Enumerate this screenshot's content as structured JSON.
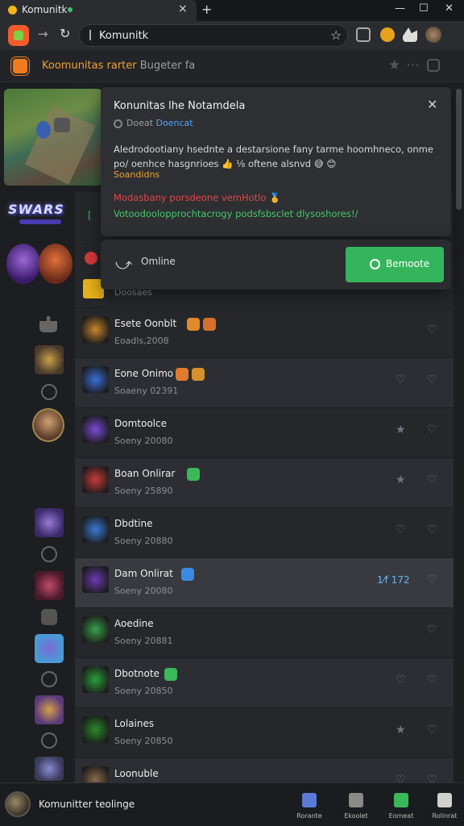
{
  "browser": {
    "tab_title": "Komunitk",
    "tab_close": "×",
    "new_tab": "+",
    "window_controls": [
      "—",
      "☐",
      "✕"
    ],
    "url": "Komunitk"
  },
  "page_header": {
    "title": "Koomunitas rarter",
    "subtitle": "Bugeter fa"
  },
  "popup": {
    "title": "Konunitas lhe Notamdela",
    "meta_prefix": "Doeat",
    "meta_link": "Doencat",
    "description": "Aledrodootiany hsednte a destarsione fany tarme hoomhneco, onme po/ oenhce hasgnrioes 👍 ⅛ oftene alsnvd 😅 😊",
    "orange_line": "Soandidns",
    "red_line": "Modasbany porsdeone vemHotlo 🏅",
    "green_line": "Votoodoolopprochtacrogy podsfsbsclet dlysoshores!/",
    "close_label": "✕"
  },
  "action_card": {
    "label": "Omline",
    "button_label": "Bemoote"
  },
  "list": {
    "partial_row": "Doosaes",
    "rows": [
      {
        "name": "Esete Oonblt",
        "sub": "Eoadls,2008",
        "badge": "#e08a2c",
        "badge2": "#d6702c",
        "thumb": "#c8842c",
        "act": "",
        "count": ""
      },
      {
        "name": "Eone Onimo",
        "sub": "Soaeny 02391",
        "badge": "#e07a2c",
        "badge2": "#d6902c",
        "thumb": "#3a6fd6",
        "act": "♡",
        "count": ""
      },
      {
        "name": "Domtoolce",
        "sub": "Soeny 20080",
        "badge": "",
        "badge2": "",
        "thumb": "#7a4ad6",
        "act": "★",
        "count": ""
      },
      {
        "name": "Boan Onlirar",
        "sub": "Soeny 25890",
        "badge": "#3ab85a",
        "badge2": "",
        "thumb": "#c83a3a",
        "act": "★",
        "count": ""
      },
      {
        "name": "Dbdtine",
        "sub": "Soeny 20880",
        "badge": "",
        "badge2": "",
        "thumb": "#3a7ad6",
        "act": "♡",
        "count": ""
      },
      {
        "name": "Dam Onlirat",
        "sub": "Soeny 20080",
        "badge": "#3a8ae0",
        "badge2": "",
        "thumb": "#6a3ab0",
        "act": "",
        "count": "1⁄f 172"
      },
      {
        "name": "Aoedine",
        "sub": "Soeny 20881",
        "badge": "",
        "badge2": "",
        "thumb": "#3aa04a",
        "act": "",
        "count": ""
      },
      {
        "name": "Dbotnote",
        "sub": "Soeny 20850",
        "badge": "#3ab85a",
        "badge2": "",
        "thumb": "#2aa03a",
        "act": "♡",
        "count": ""
      },
      {
        "name": "Lolaines",
        "sub": "Soeny 20850",
        "badge": "",
        "badge2": "",
        "thumb": "#2a8a2a",
        "act": "★",
        "count": ""
      },
      {
        "name": "Loonuble",
        "sub": "",
        "badge": "",
        "badge2": "",
        "thumb": "#8a6a4a",
        "act": "♡",
        "count": ""
      }
    ],
    "heart": "♡"
  },
  "bottom_bar": {
    "profile_name": "Komunitter teolinge",
    "nav": [
      {
        "label": "Rorante",
        "color": "#5a7ad6"
      },
      {
        "label": "Ekoolet",
        "color": "#8a8a8a"
      },
      {
        "label": "Eomeat",
        "color": "#3ab85a"
      },
      {
        "label": "Rolinrat",
        "color": "#d0d0d0"
      }
    ]
  },
  "colors": {
    "accent_orange": "#f0a230",
    "accent_green": "#34b55b",
    "link_blue": "#4fa6ff",
    "warning_red": "#e04848"
  }
}
